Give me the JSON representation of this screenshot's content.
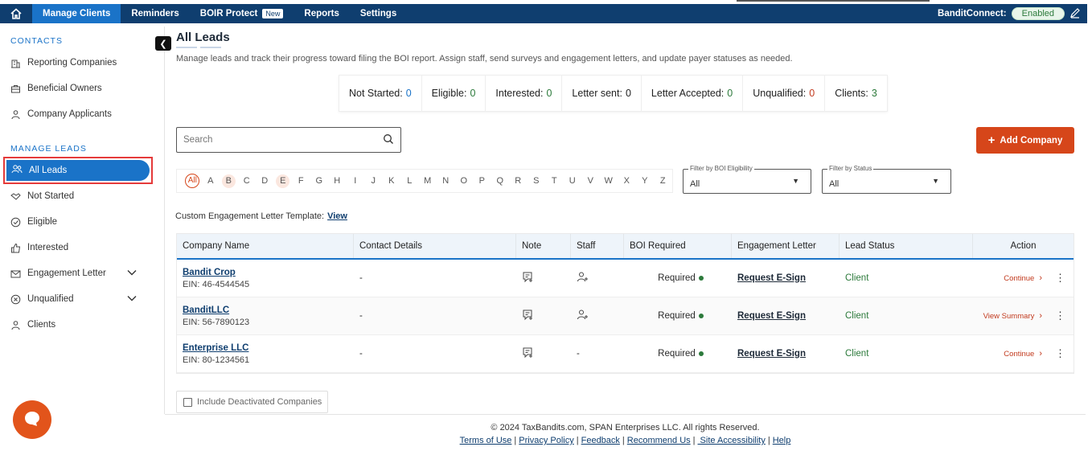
{
  "nav": {
    "items": [
      {
        "label": "Manage Clients",
        "active": true
      },
      {
        "label": "Reminders",
        "active": false
      },
      {
        "label": "BOIR Protect",
        "active": false,
        "badge": "New"
      },
      {
        "label": "Reports",
        "active": false
      },
      {
        "label": "Settings",
        "active": false
      }
    ],
    "bandit_connect_label": "BanditConnect:",
    "bandit_connect_status": "Enabled"
  },
  "sidebar": {
    "contacts_heading": "CONTACTS",
    "contacts": [
      {
        "label": "Reporting Companies",
        "icon": "building-icon"
      },
      {
        "label": "Beneficial Owners",
        "icon": "briefcase-icon"
      },
      {
        "label": "Company Applicants",
        "icon": "person-icon"
      }
    ],
    "leads_heading": "MANAGE LEADS",
    "leads": [
      {
        "label": "All Leads",
        "icon": "users-icon",
        "active": true
      },
      {
        "label": "Not Started",
        "icon": "handshake-icon"
      },
      {
        "label": "Eligible",
        "icon": "check-circle-icon"
      },
      {
        "label": "Interested",
        "icon": "thumbs-up-icon"
      },
      {
        "label": "Engagement Letter",
        "icon": "mail-icon",
        "expandable": true
      },
      {
        "label": "Unqualified",
        "icon": "x-circle-icon",
        "expandable": true
      },
      {
        "label": "Clients",
        "icon": "person-icon"
      }
    ]
  },
  "page": {
    "title": "All Leads",
    "subtitle": "Manage leads and track their progress toward filing the BOI report. Assign staff, send surveys and engagement letters, and update payer statuses as needed."
  },
  "stats": [
    {
      "label": "Not Started:",
      "value": "0",
      "color": "#1a73c8"
    },
    {
      "label": "Eligible:",
      "value": "0",
      "color": "#2c7a3b"
    },
    {
      "label": "Interested:",
      "value": "0",
      "color": "#2c7a3b"
    },
    {
      "label": "Letter sent:",
      "value": "0",
      "color": "#222222"
    },
    {
      "label": "Letter Accepted:",
      "value": "0",
      "color": "#2c7a3b"
    },
    {
      "label": "Unqualified:",
      "value": "0",
      "color": "#c23a1e"
    },
    {
      "label": "Clients:",
      "value": "3",
      "color": "#2c7a3b"
    }
  ],
  "search": {
    "placeholder": "Search",
    "value": ""
  },
  "add_company_label": "Add Company",
  "alphabet": [
    "All",
    "A",
    "B",
    "C",
    "D",
    "E",
    "F",
    "G",
    "H",
    "I",
    "J",
    "K",
    "L",
    "M",
    "N",
    "O",
    "P",
    "Q",
    "R",
    "S",
    "T",
    "U",
    "V",
    "W",
    "X",
    "Y",
    "Z"
  ],
  "filters": {
    "boi_label": "Filter by BOI Eligibility",
    "boi_value": "All",
    "status_label": "Filter by Status",
    "status_value": "All"
  },
  "template": {
    "label": "Custom Engagement Letter Template:",
    "link": "View"
  },
  "table": {
    "headers": [
      "Company Name",
      "Contact Details",
      "Note",
      "Staff",
      "BOI Required",
      "Engagement Letter",
      "Lead Status",
      "Action"
    ],
    "rows": [
      {
        "company": "Bandit Crop",
        "ein": "EIN: 46-4544545",
        "contact": "-",
        "staff": "assign",
        "boi": "Required",
        "letter": "Request E-Sign",
        "status": "Client",
        "action": "Continue"
      },
      {
        "company": "BanditLLC",
        "ein": "EIN: 56-7890123",
        "contact": "-",
        "staff": "assign",
        "boi": "Required",
        "letter": "Request E-Sign",
        "status": "Client",
        "action": "View Summary"
      },
      {
        "company": "Enterprise LLC",
        "ein": "EIN: 80-1234561",
        "contact": "-",
        "staff": "-",
        "boi": "Required",
        "letter": "Request E-Sign",
        "status": "Client",
        "action": "Continue"
      }
    ]
  },
  "deactivated_label": "Include Deactivated Companies",
  "footer": {
    "copyright": "© 2024 TaxBandits.com, SPAN Enterprises LLC. All rights Reserved.",
    "links": [
      "Terms of Use",
      "Privacy Policy",
      "Feedback",
      "Recommend Us",
      " Site Accessibility",
      "Help"
    ]
  }
}
